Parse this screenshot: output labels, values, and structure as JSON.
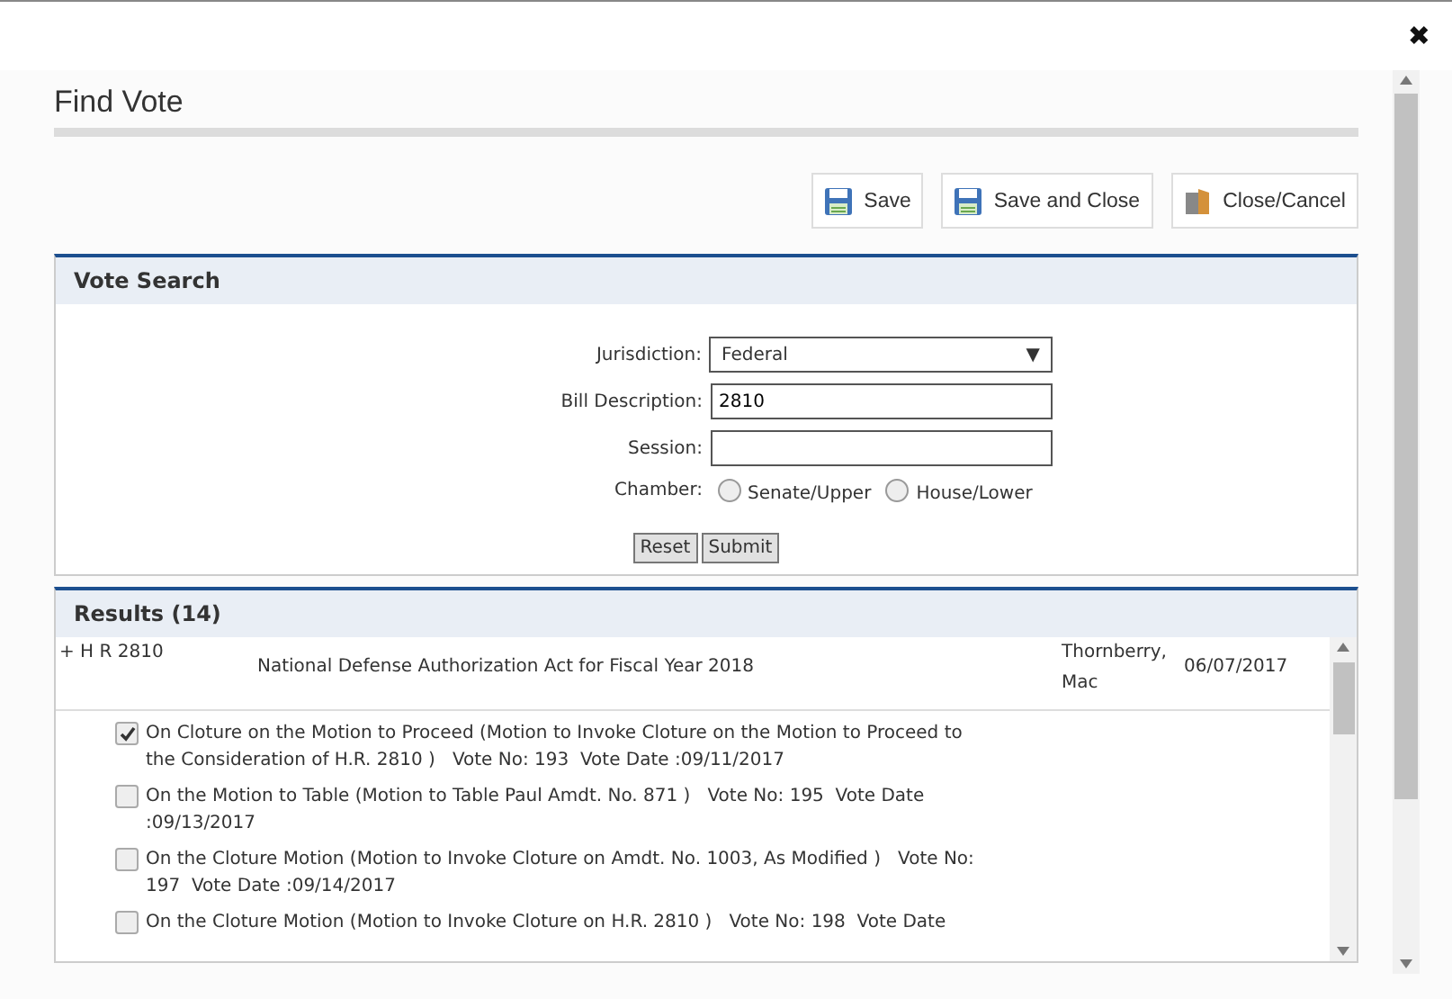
{
  "dialog": {
    "close": "✖",
    "title": "Find Vote"
  },
  "toolbar": [
    {
      "label": "Save",
      "kind": "save"
    },
    {
      "label": "Save and Close",
      "kind": "save"
    },
    {
      "label": "Close/Cancel",
      "kind": "door"
    }
  ],
  "vote_search": {
    "title": "Vote Search",
    "jurisdiction": {
      "label": "Jurisdiction:",
      "value": "Federal",
      "arrow": "▼"
    },
    "bill_description": {
      "label": "Bill Description:",
      "value": "2810"
    },
    "session": {
      "label": "Session:"
    },
    "chamber": {
      "label": "Chamber:",
      "options": [
        {
          "label": "Senate/Upper",
          "selected": false
        },
        {
          "label": "House/Lower",
          "selected": false
        }
      ]
    },
    "buttons": [
      "Reset",
      "Submit"
    ]
  },
  "results": {
    "title": "Results (14)",
    "bill": {
      "toggle": "+",
      "number": "H R 2810",
      "description": "National Defense Authorization Act for Fiscal Year 2018",
      "sponsor": "Thornberry, Mac",
      "date": "06/07/2017"
    },
    "votes": [
      {
        "text": "On Cloture on the Motion to Proceed (Motion to Invoke Cloture on the Motion to Proceed to the Consideration of H.R. 2810 )   Vote No: 193  Vote Date :09/11/2017",
        "checked": true
      },
      {
        "text": "On the Motion to Table (Motion to Table Paul Amdt. No. 871 )   Vote No: 195  Vote Date :09/13/2017",
        "checked": false
      },
      {
        "text": "On the Cloture Motion (Motion to Invoke Cloture on Amdt. No. 1003, As Modified )   Vote No: 197  Vote Date :09/14/2017",
        "checked": false
      },
      {
        "text": "On the Cloture Motion (Motion to Invoke Cloture on H.R. 2810 )   Vote No: 198  Vote Date",
        "checked": false
      }
    ]
  }
}
